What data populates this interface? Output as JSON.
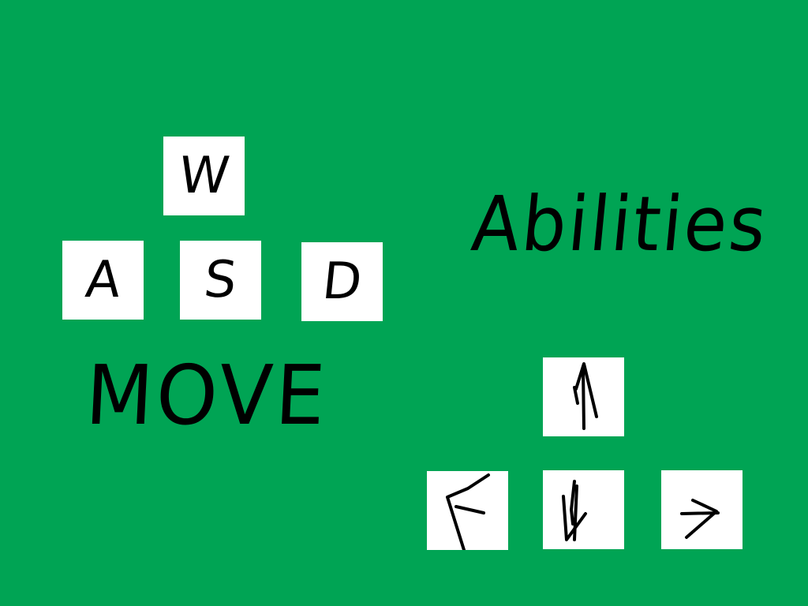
{
  "background_color": "#00a454",
  "key_color": "#ffffff",
  "ink_color": "#000000",
  "movement": {
    "label": "MOVE",
    "keys": {
      "up": "W",
      "left": "A",
      "down": "S",
      "right": "D"
    }
  },
  "abilities": {
    "label": "Abilities",
    "keys": {
      "up": "arrow-up-icon",
      "left": "arrow-left-icon",
      "down": "arrow-down-icon",
      "right": "arrow-right-icon"
    }
  }
}
